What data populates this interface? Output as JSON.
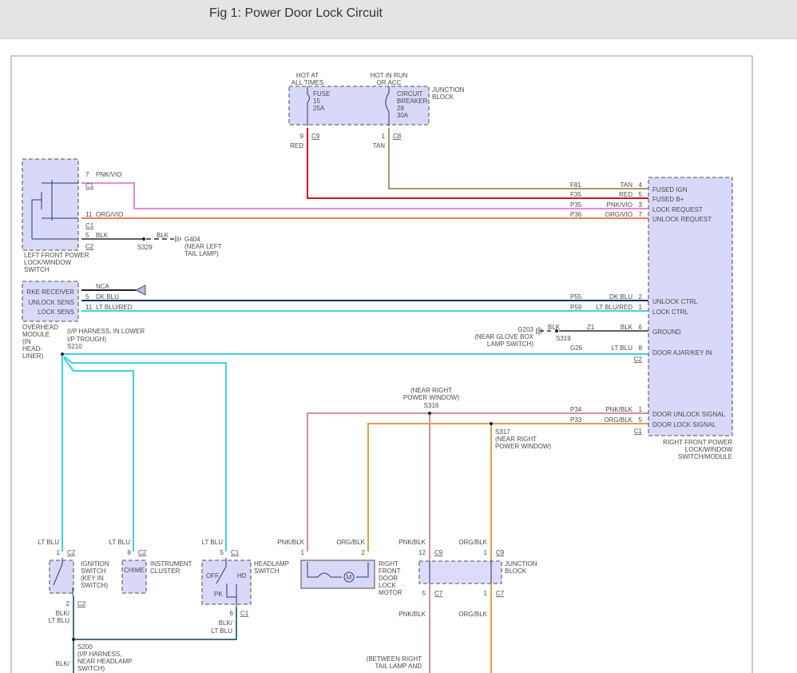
{
  "title": "Fig 1: Power Door Lock Circuit",
  "colors": {
    "red": "#d01818",
    "tan": "#a89868",
    "pnk_vio": "#e888d8",
    "org_vio": "#f07a5a",
    "dk_blu": "#1c2a78",
    "lt_blu": "#40d4dc",
    "blk": "#606060",
    "pnk_blk": "#d4909c",
    "org_blk": "#dca050",
    "component_fill": "#d8d8f8"
  },
  "top_junction": {
    "hot1": [
      "HOT AT",
      "ALL TIMES"
    ],
    "hot2": [
      "HOT IN RUN",
      "OR ACC"
    ],
    "label": [
      "JUNCTION",
      "BLOCK"
    ],
    "fuse": [
      "FUSE",
      "15",
      "25A"
    ],
    "breaker": [
      "CIRCUIT",
      "BREAKER",
      "28",
      "30A"
    ],
    "pin1": "9",
    "conn1": "C9",
    "wire1": "RED",
    "pin2": "1",
    "conn2": "C8",
    "wire2": "TAN"
  },
  "left_switch": {
    "name": [
      "LEFT FRONT POWER",
      "LOCK/WINDOW",
      "SWITCH"
    ],
    "w1": {
      "pin": "7",
      "color": "PNK/VIO",
      "conn": "C1"
    },
    "w2": {
      "pin": "11",
      "color": "ORG/VIO",
      "conn": "C1"
    },
    "w3": {
      "pin": "5",
      "color": "BLK",
      "conn": "C2"
    },
    "splice": "S329",
    "blk2": "BLK",
    "ground": "G404",
    "ground_loc": [
      "(NEAR LEFT",
      "TAIL LAMP)"
    ]
  },
  "overhead": {
    "pins": [
      "RKE RECEIVER",
      "UNLOCK SENS",
      "LOCK SENS"
    ],
    "name": [
      "OVERHEAD",
      "MODULE",
      "(IN",
      "HEAD-",
      "LINER)"
    ],
    "nca": "NCA",
    "w1": {
      "pin": "5",
      "color": "DK BLU"
    },
    "w2": {
      "pin": "11",
      "color": "LT BLU/RED"
    }
  },
  "s210": {
    "loc": [
      "(I/P HARNESS, IN LOWER",
      "I/P TROUGH)"
    ],
    "id": "S210"
  },
  "right_module": {
    "name": [
      "RIGHT FRONT POWER",
      "LOCK/WINDOW",
      "SWITCH/MODULE"
    ],
    "pins": [
      {
        "label": "FUSED IGN",
        "circuit": "F81",
        "color": "TAN",
        "pin": "4"
      },
      {
        "label": "FUSED B+",
        "circuit": "F35",
        "color": "RED",
        "pin": "5"
      },
      {
        "label": "LOCK REQUEST",
        "circuit": "P35",
        "color": "PNK/VIO",
        "pin": "3"
      },
      {
        "label": "UNLOCK REQUEST",
        "circuit": "P36",
        "color": "ORG/VIO",
        "pin": "7"
      },
      {
        "label": "UNLOCK CTRL",
        "circuit": "P55",
        "color": "DK BLU",
        "pin": "2"
      },
      {
        "label": "LOCK CTRL",
        "circuit": "P59",
        "color": "LT BLU/RED",
        "pin": "1"
      },
      {
        "label": "GROUND",
        "circuit": "Z1",
        "color": "BLK",
        "pin": "6"
      },
      {
        "label": "DOOR AJAR/KEY IN",
        "circuit": "G26",
        "color": "LT BLU",
        "pin": "8"
      },
      {
        "label": "DOOR UNLOCK SIGNAL",
        "circuit": "P34",
        "color": "PNK/BLK",
        "pin": "1"
      },
      {
        "label": "DOOR LOCK SIGNAL",
        "circuit": "P33",
        "color": "ORG/BLK",
        "pin": "5"
      }
    ],
    "conn_c2": "C2",
    "conn_c1": "C1",
    "ground": "G203",
    "ground_loc": [
      "(NEAR GLOVE BOX",
      "LAMP SWITCH)"
    ],
    "ground_blk": "BLK",
    "splice": "S319"
  },
  "s316": {
    "loc": [
      "(NEAR RIGHT",
      "POWER WINDOW)"
    ],
    "id": "S316"
  },
  "s317": {
    "id": "S317",
    "loc": [
      "(NEAR RIGHT",
      "POWER WINDOW)"
    ]
  },
  "ignition": {
    "wire": "LT BLU",
    "pin": "1",
    "conn": "C2",
    "name": [
      "IGNITION",
      "SWITCH",
      "(KEY IN",
      "SWITCH)"
    ],
    "pin_out": "2",
    "conn_out": "C2",
    "wire_out": [
      "BLK/",
      "LT BLU"
    ]
  },
  "cluster": {
    "wire": "LT BLU",
    "pin": "8",
    "conn": "C2",
    "inner": "CHIME",
    "name": [
      "INSTRUMENT",
      "CLUSTER"
    ]
  },
  "headlamp": {
    "wire": "LT BLU",
    "pin": "5",
    "conn": "C1",
    "name": [
      "HEADLAMP",
      "SWITCH"
    ],
    "off": "OFF",
    "hd": "HD",
    "pk": "PK",
    "pin_out": "6",
    "conn_out": "C1",
    "wire_out": [
      "BLK/",
      "LT BLU"
    ]
  },
  "s200": {
    "id": "S200",
    "loc": [
      "(I/P HARNESS,",
      "NEAR HEADLAMP",
      "SWITCH)"
    ],
    "wire": "BLK/"
  },
  "motor": {
    "w1": "PNK/BLK",
    "p1": "1",
    "w2": "ORG/BLK",
    "p2": "2",
    "symbol": "M",
    "name": [
      "RIGHT",
      "FRONT",
      "DOOR",
      "LOCK",
      "MOTOR"
    ]
  },
  "bottom_junction": {
    "w1": "PNK/BLK",
    "p1": "12",
    "c1": "C9",
    "w2": "ORG/BLK",
    "p2": "1",
    "c2": "C9",
    "name": [
      "JUNCTION",
      "BLOCK"
    ],
    "p3": "5",
    "c3": "C7",
    "p4": "1",
    "c4": "C7",
    "w3": "PNK/BLK",
    "w4": "ORG/BLK",
    "loc": [
      "(BETWEEN RIGHT",
      "TAIL LAMP AND"
    ]
  }
}
